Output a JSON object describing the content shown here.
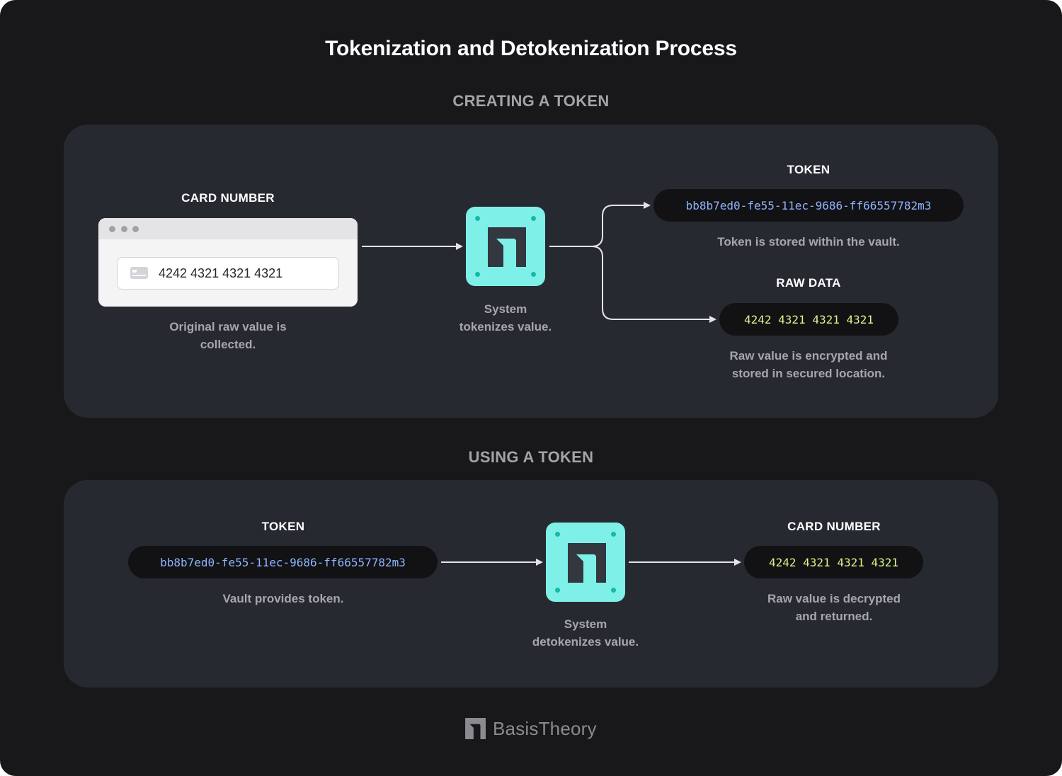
{
  "title": "Tokenization and Detokenization Process",
  "creating": {
    "section_title": "CREATING A TOKEN",
    "card_label": "CARD NUMBER",
    "card_value": "4242 4321 4321 4321",
    "card_caption_1": "Original raw value is",
    "card_caption_2": "collected.",
    "system_caption_1": "System",
    "system_caption_2": "tokenizes value.",
    "token_label": "TOKEN",
    "token_value": "bb8b7ed0-fe55-11ec-9686-ff66557782m3",
    "token_caption": "Token is stored within the vault.",
    "raw_label": "RAW DATA",
    "raw_value": "4242 4321 4321 4321",
    "raw_caption_1": "Raw value is encrypted and",
    "raw_caption_2": "stored in secured location."
  },
  "using": {
    "section_title": "USING A TOKEN",
    "token_label": "TOKEN",
    "token_value": "bb8b7ed0-fe55-11ec-9686-ff66557782m3",
    "token_caption": "Vault provides token.",
    "system_caption_1": "System",
    "system_caption_2": "detokenizes value.",
    "card_label": "CARD NUMBER",
    "card_value": "4242 4321 4321 4321",
    "card_caption_1": "Raw value is decrypted",
    "card_caption_2": "and returned."
  },
  "footer": {
    "brand": "BasisTheory"
  },
  "colors": {
    "background": "#18181b",
    "panel": "#262a30",
    "accent": "#7ef0e8",
    "token_text": "#8fb4ff",
    "raw_text": "#d9f58a"
  },
  "icons": [
    "card-icon",
    "basis-theory-logo-icon",
    "arrow-icon"
  ]
}
